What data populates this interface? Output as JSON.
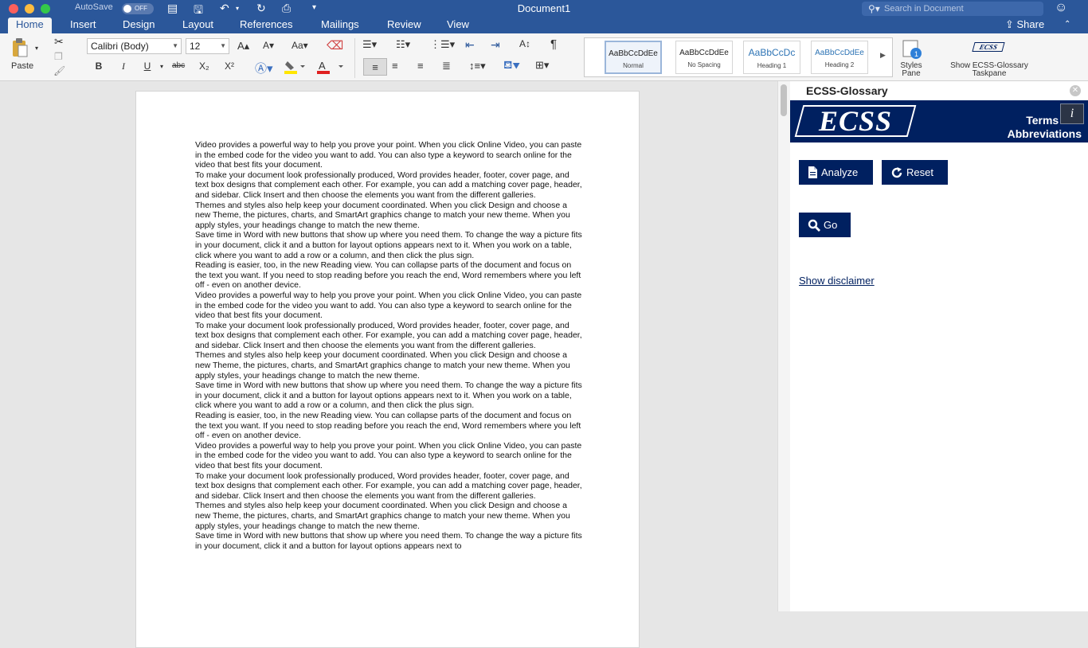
{
  "titlebar": {
    "autosave_label": "AutoSave",
    "autosave_state": "OFF",
    "document_title": "Document1",
    "search_placeholder": "Search in Document"
  },
  "tabs": [
    "Home",
    "Insert",
    "Design",
    "Layout",
    "References",
    "Mailings",
    "Review",
    "View"
  ],
  "share_label": "Share",
  "ribbon": {
    "paste_label": "Paste",
    "font_name": "Calibri (Body)",
    "font_size": "12",
    "bold": "B",
    "italic": "I",
    "underline": "U",
    "strikethrough": "abc",
    "subscript": "X₂",
    "superscript": "X²",
    "pilcrow": "¶",
    "styles": [
      {
        "preview": "AaBbCcDdEe",
        "name": "Normal"
      },
      {
        "preview": "AaBbCcDdEe",
        "name": "No Spacing"
      },
      {
        "preview": "AaBbCcDc",
        "name": "Heading 1"
      },
      {
        "preview": "AaBbCcDdEe",
        "name": "Heading 2"
      }
    ],
    "styles_pane_label": "Styles Pane",
    "ecss_taskpane_label": "Show ECSS-Glossary Taskpane",
    "ecss_logo_small": "ECSS"
  },
  "document": {
    "paragraphs": [
      "Video provides a powerful way to help you prove your point. When you click Online Video, you can paste in the embed code for the video you want to add. You can also type a keyword to search online for the video that best fits your document.",
      "To make your document look professionally produced, Word provides header, footer, cover page, and text box designs that complement each other. For example, you can add a matching cover page, header, and sidebar. Click Insert and then choose the elements you want from the different galleries.",
      "Themes and styles also help keep your document coordinated. When you click Design and choose a new Theme, the pictures, charts, and SmartArt graphics change to match your new theme. When you apply styles, your headings change to match the new theme.",
      "Save time in Word with new buttons that show up where you need them. To change the way a picture fits in your document, click it and a button for layout options appears next to it. When you work on a table, click where you want to add a row or a column, and then click the plus sign.",
      "Reading is easier, too, in the new Reading view. You can collapse parts of the document and focus on the text you want. If you need to stop reading before you reach the end, Word remembers where you left off - even on another device.",
      "Video provides a powerful way to help you prove your point. When you click Online Video, you can paste in the embed code for the video you want to add. You can also type a keyword to search online for the video that best fits your document.",
      "To make your document look professionally produced, Word provides header, footer, cover page, and text box designs that complement each other. For example, you can add a matching cover page, header, and sidebar. Click Insert and then choose the elements you want from the different galleries.",
      "Themes and styles also help keep your document coordinated. When you click Design and choose a new Theme, the pictures, charts, and SmartArt graphics change to match your new theme. When you apply styles, your headings change to match the new theme.",
      "Save time in Word with new buttons that show up where you need them. To change the way a picture fits in your document, click it and a button for layout options appears next to it. When you work on a table, click where you want to add a row or a column, and then click the plus sign.",
      "Reading is easier, too, in the new Reading view. You can collapse parts of the document and focus on the text you want. If you need to stop reading before you reach the end, Word remembers where you left off - even on another device.",
      "Video provides a powerful way to help you prove your point. When you click Online Video, you can paste in the embed code for the video you want to add. You can also type a keyword to search online for the video that best fits your document.",
      "To make your document look professionally produced, Word provides header, footer, cover page, and text box designs that complement each other. For example, you can add a matching cover page, header, and sidebar. Click Insert and then choose the elements you want from the different galleries.",
      "Themes and styles also help keep your document coordinated. When you click Design and choose a new Theme, the pictures, charts, and SmartArt graphics change to match your new theme. When you apply styles, your headings change to match the new theme.",
      "Save time in Word with new buttons that show up where you need them. To change the way a picture fits in your document, click it and a button for layout options appears next to"
    ]
  },
  "taskpane": {
    "title": "ECSS-Glossary",
    "logo_text": "ECSS",
    "banner_line1": "Terms and",
    "banner_line2": "Abbreviations",
    "info_label": "i",
    "analyze_label": "Analyze",
    "reset_label": "Reset",
    "go_label": "Go",
    "disclaimer_label": "Show disclaimer"
  },
  "colors": {
    "word_blue": "#2b579a",
    "ecss_navy": "#002060"
  }
}
